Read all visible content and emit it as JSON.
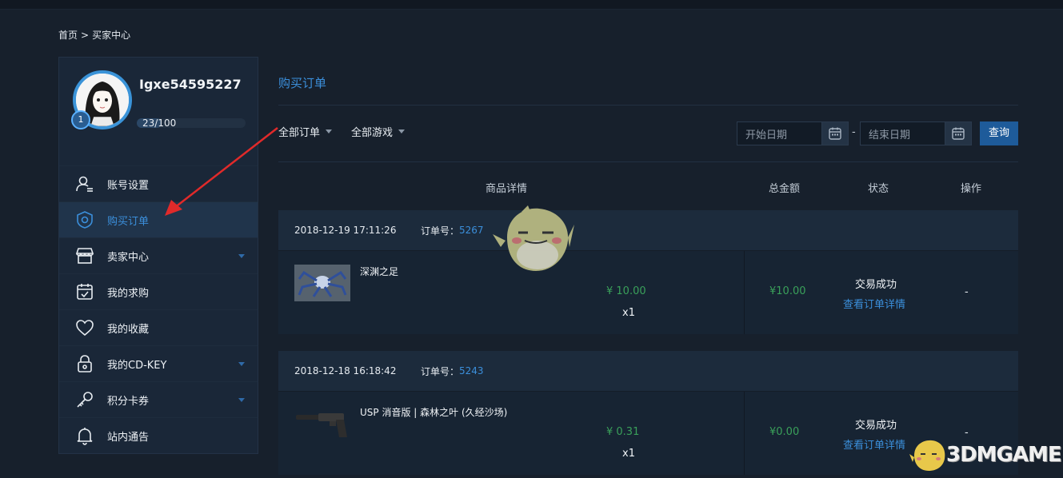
{
  "breadcrumb": {
    "home": "首页",
    "sep": ">",
    "current": "买家中心"
  },
  "profile": {
    "username": "Igxe54595227",
    "level": "1",
    "progress_text": "23/100",
    "progress_fraction": 0.23
  },
  "sidebar": {
    "items": [
      {
        "label": "账号设置",
        "icon": "user-settings-icon",
        "active": false,
        "has_caret": false
      },
      {
        "label": "购买订单",
        "icon": "shield-icon",
        "active": true,
        "has_caret": false
      },
      {
        "label": "卖家中心",
        "icon": "store-icon",
        "active": false,
        "has_caret": true
      },
      {
        "label": "我的求购",
        "icon": "calendar-check-icon",
        "active": false,
        "has_caret": false
      },
      {
        "label": "我的收藏",
        "icon": "heart-icon",
        "active": false,
        "has_caret": false
      },
      {
        "label": "我的CD-KEY",
        "icon": "lock-icon",
        "active": false,
        "has_caret": true
      },
      {
        "label": "积分卡券",
        "icon": "key-icon",
        "active": false,
        "has_caret": true
      },
      {
        "label": "站内通告",
        "icon": "bell-icon",
        "active": false,
        "has_caret": false
      }
    ]
  },
  "main": {
    "title": "购买订单",
    "filters": {
      "order_type": "全部订单",
      "game": "全部游戏"
    },
    "date": {
      "start_placeholder": "开始日期",
      "end_placeholder": "结束日期",
      "dash": "-",
      "query_label": "查询"
    },
    "headers": {
      "details": "商品详情",
      "total": "总金额",
      "status": "状态",
      "action": "操作"
    },
    "orders": [
      {
        "time": "2018-12-19 17:11:26",
        "order_label": "订单号：",
        "order_no": "5267",
        "item_name": "深渊之足",
        "price": "¥ 10.00",
        "qty": "x1",
        "total": "¥10.00",
        "status": "交易成功",
        "detail_link": "查看订单详情",
        "action": "-"
      },
      {
        "time": "2018-12-18 16:18:42",
        "order_label": "订单号：",
        "order_no": "5243",
        "item_name": "USP 消音版 | 森林之叶 (久经沙场)",
        "price": "¥ 0.31",
        "qty": "x1",
        "total": "¥0.00",
        "status": "交易成功",
        "detail_link": "查看订单详情",
        "action": "-"
      }
    ]
  },
  "watermark": {
    "text": "3DMGAME"
  },
  "colors": {
    "accent": "#3b8fdb",
    "price_green": "#3aa05a",
    "annotation_red": "#e02a2a",
    "button_blue": "#1e5b9a"
  }
}
